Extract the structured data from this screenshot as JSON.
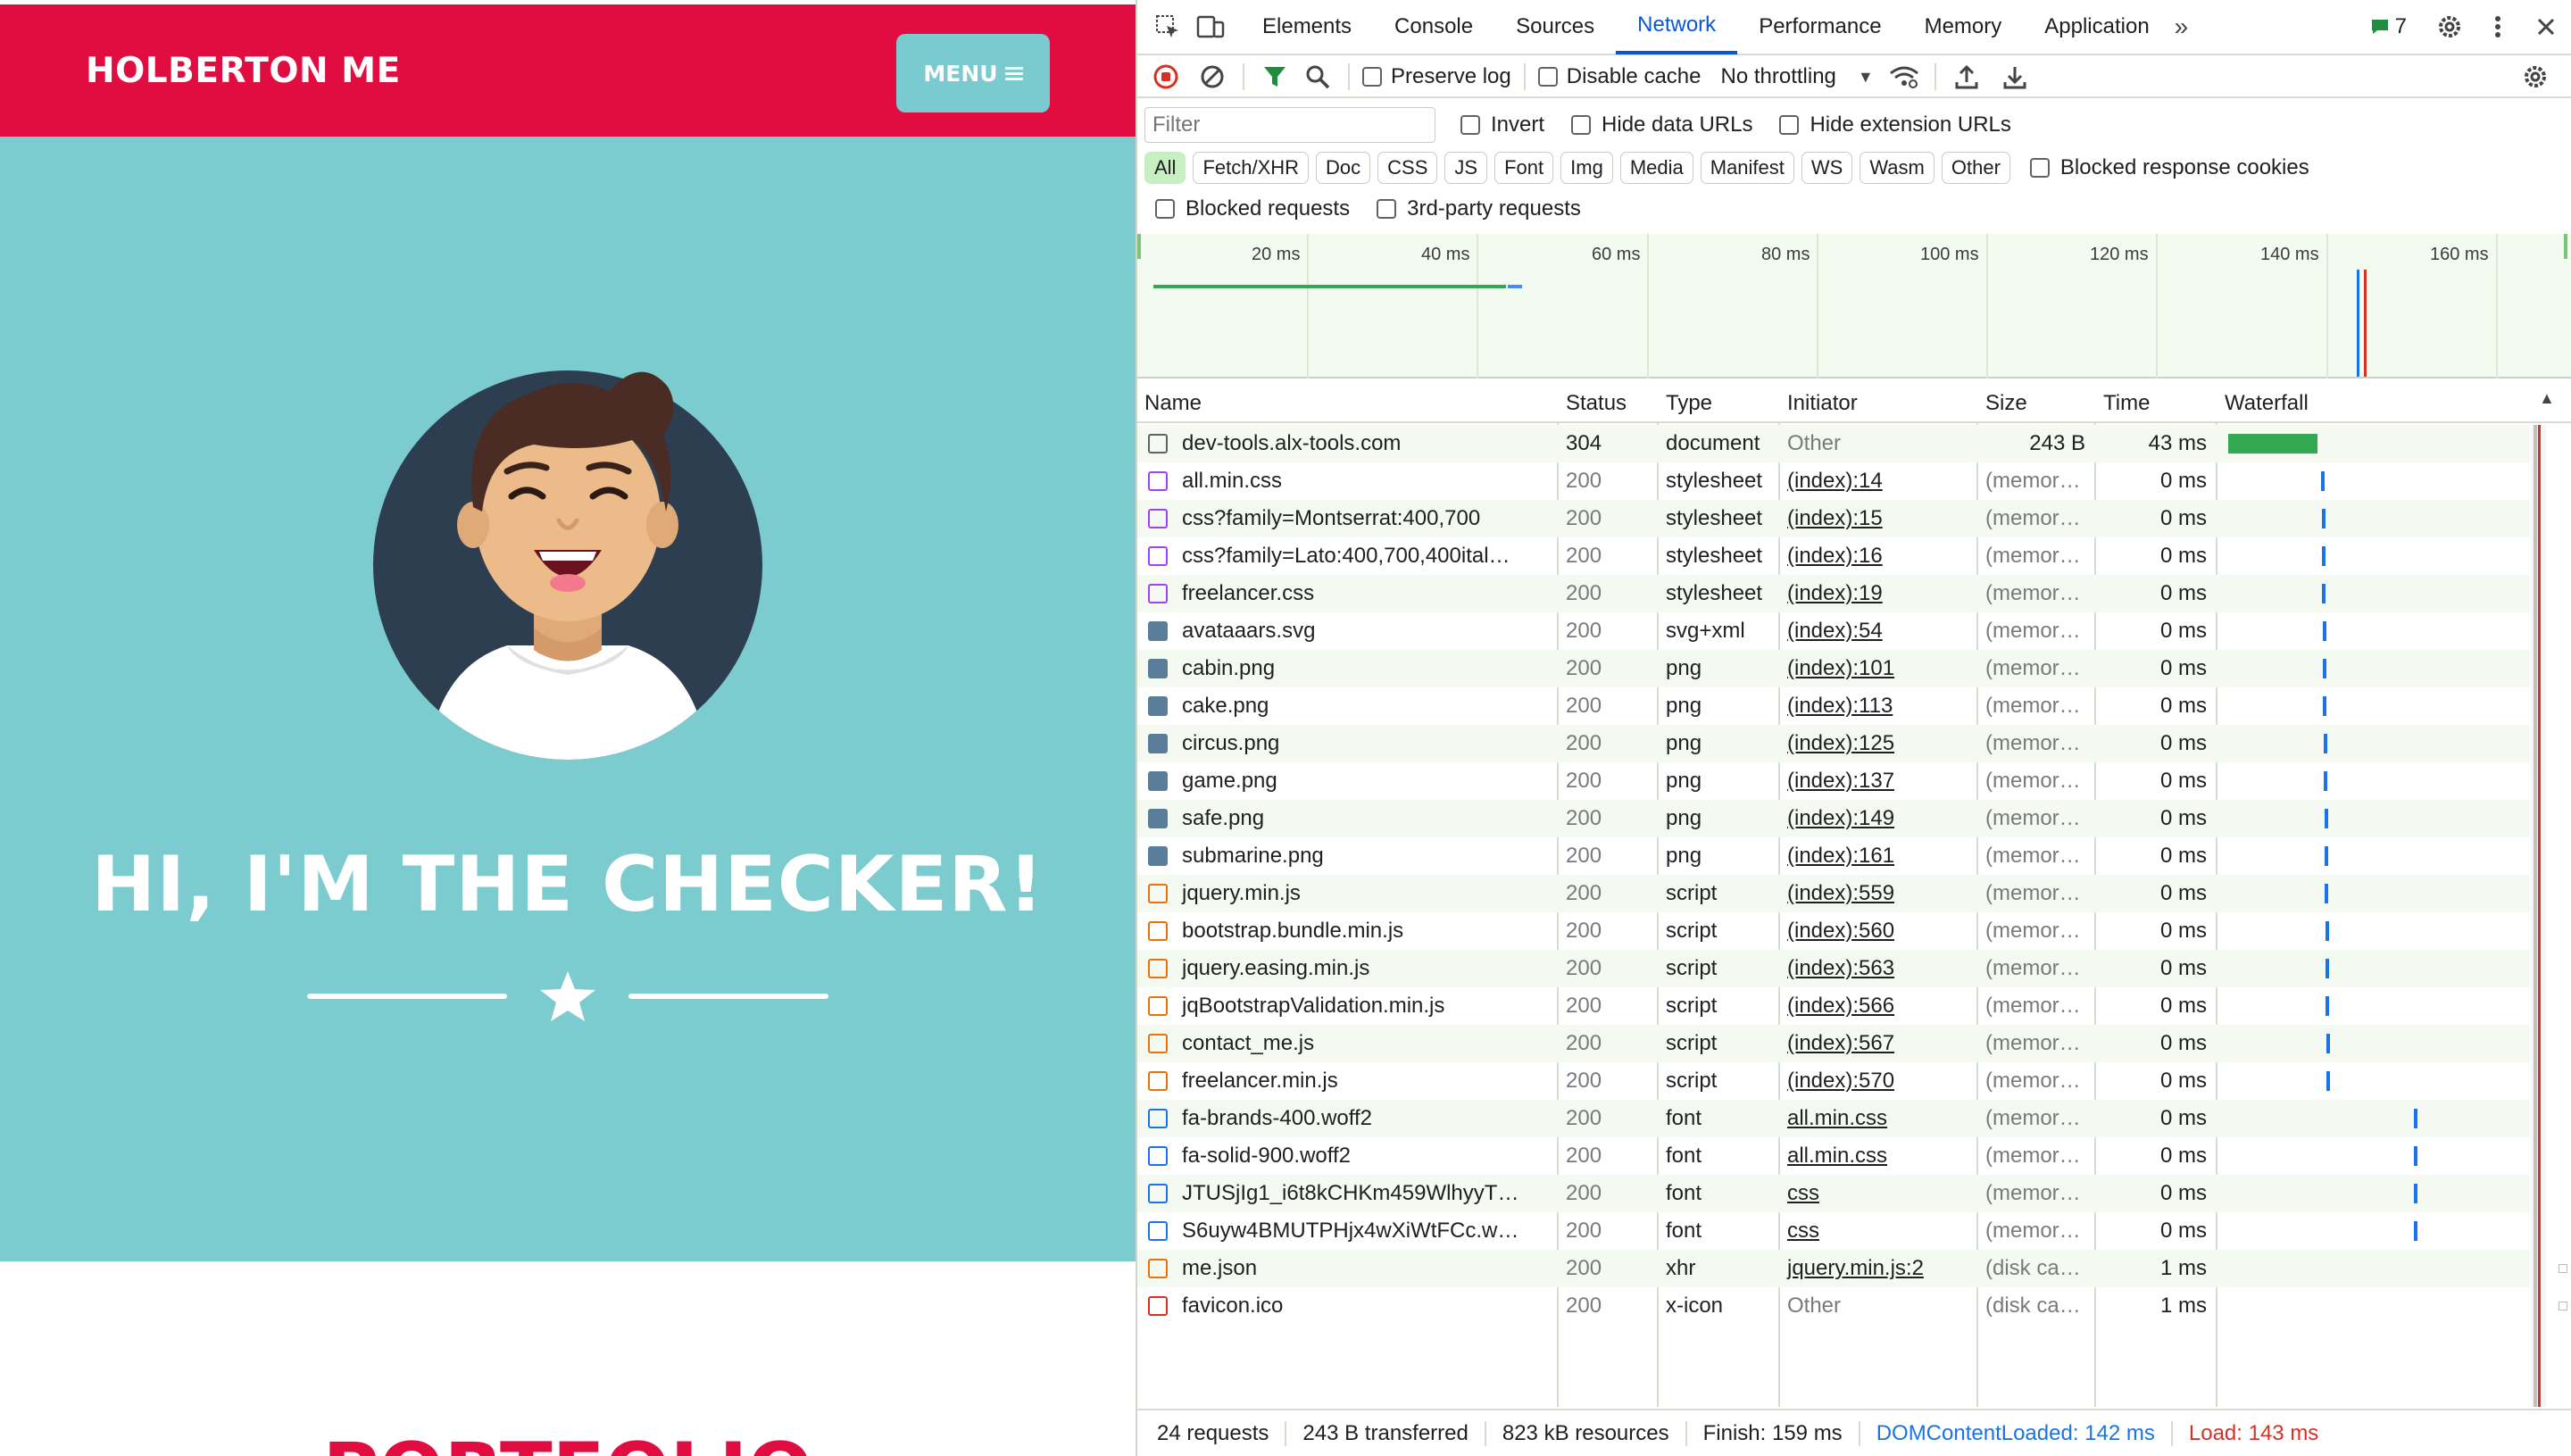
{
  "site": {
    "brand": "HOLBERTON ME",
    "menu_label": "MENU",
    "hero_title": "HI, I'M THE CHECKER!",
    "next_section_title": "PORTFOLIO",
    "colors": {
      "nav": "#e10c40",
      "hero": "#7ccbcf",
      "menu_button": "#79cbd0"
    }
  },
  "devtools": {
    "tabs": [
      "Elements",
      "Console",
      "Sources",
      "Network",
      "Performance",
      "Memory",
      "Application"
    ],
    "active_tab": "Network",
    "issues_count": "7",
    "toolbar": {
      "preserve_log": "Preserve log",
      "disable_cache": "Disable cache",
      "throttling": "No throttling"
    },
    "filter": {
      "placeholder": "Filter",
      "invert": "Invert",
      "hide_data_urls": "Hide data URLs",
      "hide_extension_urls": "Hide extension URLs",
      "type_chips": [
        "All",
        "Fetch/XHR",
        "Doc",
        "CSS",
        "JS",
        "Font",
        "Img",
        "Media",
        "Manifest",
        "WS",
        "Wasm",
        "Other"
      ],
      "active_chip": "All",
      "blocked_response_cookies": "Blocked response cookies",
      "blocked_requests": "Blocked requests",
      "third_party_requests": "3rd-party requests"
    },
    "overview_ticks": [
      "20 ms",
      "40 ms",
      "60 ms",
      "80 ms",
      "100 ms",
      "120 ms",
      "140 ms",
      "160 ms"
    ],
    "columns": [
      "Name",
      "Status",
      "Type",
      "Initiator",
      "Size",
      "Time",
      "Waterfall"
    ],
    "requests": [
      {
        "name": "dev-tools.alx-tools.com",
        "status": "304",
        "type": "document",
        "initiator": "Other",
        "size": "243 B",
        "time": "43 ms",
        "icon": "document-icon"
      },
      {
        "name": "all.min.css",
        "status": "200",
        "type": "stylesheet",
        "initiator": "(index):14",
        "size": "(memor…",
        "time": "0 ms",
        "icon": "stylesheet-icon"
      },
      {
        "name": "css?family=Montserrat:400,700",
        "status": "200",
        "type": "stylesheet",
        "initiator": "(index):15",
        "size": "(memor…",
        "time": "0 ms",
        "icon": "stylesheet-icon"
      },
      {
        "name": "css?family=Lato:400,700,400ital…",
        "status": "200",
        "type": "stylesheet",
        "initiator": "(index):16",
        "size": "(memor…",
        "time": "0 ms",
        "icon": "stylesheet-icon"
      },
      {
        "name": "freelancer.css",
        "status": "200",
        "type": "stylesheet",
        "initiator": "(index):19",
        "size": "(memor…",
        "time": "0 ms",
        "icon": "stylesheet-icon"
      },
      {
        "name": "avataaars.svg",
        "status": "200",
        "type": "svg+xml",
        "initiator": "(index):54",
        "size": "(memor…",
        "time": "0 ms",
        "icon": "image-icon"
      },
      {
        "name": "cabin.png",
        "status": "200",
        "type": "png",
        "initiator": "(index):101",
        "size": "(memor…",
        "time": "0 ms",
        "icon": "image-icon"
      },
      {
        "name": "cake.png",
        "status": "200",
        "type": "png",
        "initiator": "(index):113",
        "size": "(memor…",
        "time": "0 ms",
        "icon": "image-icon"
      },
      {
        "name": "circus.png",
        "status": "200",
        "type": "png",
        "initiator": "(index):125",
        "size": "(memor…",
        "time": "0 ms",
        "icon": "image-icon"
      },
      {
        "name": "game.png",
        "status": "200",
        "type": "png",
        "initiator": "(index):137",
        "size": "(memor…",
        "time": "0 ms",
        "icon": "image-icon"
      },
      {
        "name": "safe.png",
        "status": "200",
        "type": "png",
        "initiator": "(index):149",
        "size": "(memor…",
        "time": "0 ms",
        "icon": "image-icon"
      },
      {
        "name": "submarine.png",
        "status": "200",
        "type": "png",
        "initiator": "(index):161",
        "size": "(memor…",
        "time": "0 ms",
        "icon": "image-icon"
      },
      {
        "name": "jquery.min.js",
        "status": "200",
        "type": "script",
        "initiator": "(index):559",
        "size": "(memor…",
        "time": "0 ms",
        "icon": "script-icon"
      },
      {
        "name": "bootstrap.bundle.min.js",
        "status": "200",
        "type": "script",
        "initiator": "(index):560",
        "size": "(memor…",
        "time": "0 ms",
        "icon": "script-icon"
      },
      {
        "name": "jquery.easing.min.js",
        "status": "200",
        "type": "script",
        "initiator": "(index):563",
        "size": "(memor…",
        "time": "0 ms",
        "icon": "script-icon"
      },
      {
        "name": "jqBootstrapValidation.min.js",
        "status": "200",
        "type": "script",
        "initiator": "(index):566",
        "size": "(memor…",
        "time": "0 ms",
        "icon": "script-icon"
      },
      {
        "name": "contact_me.js",
        "status": "200",
        "type": "script",
        "initiator": "(index):567",
        "size": "(memor…",
        "time": "0 ms",
        "icon": "script-icon"
      },
      {
        "name": "freelancer.min.js",
        "status": "200",
        "type": "script",
        "initiator": "(index):570",
        "size": "(memor…",
        "time": "0 ms",
        "icon": "script-icon"
      },
      {
        "name": "fa-brands-400.woff2",
        "status": "200",
        "type": "font",
        "initiator": "all.min.css",
        "size": "(memor…",
        "time": "0 ms",
        "icon": "font-icon"
      },
      {
        "name": "fa-solid-900.woff2",
        "status": "200",
        "type": "font",
        "initiator": "all.min.css",
        "size": "(memor…",
        "time": "0 ms",
        "icon": "font-icon"
      },
      {
        "name": "JTUSjIg1_i6t8kCHKm459WlhyyT…",
        "status": "200",
        "type": "font",
        "initiator": "css",
        "size": "(memor…",
        "time": "0 ms",
        "icon": "font-icon"
      },
      {
        "name": "S6uyw4BMUTPHjx4wXiWtFCc.w…",
        "status": "200",
        "type": "font",
        "initiator": "css",
        "size": "(memor…",
        "time": "0 ms",
        "icon": "font-icon"
      },
      {
        "name": "me.json",
        "status": "200",
        "type": "xhr",
        "initiator": "jquery.min.js:2",
        "size": "(disk ca…",
        "time": "1 ms",
        "icon": "xhr-icon"
      },
      {
        "name": "favicon.ico",
        "status": "200",
        "type": "x-icon",
        "initiator": "Other",
        "size": "(disk ca…",
        "time": "1 ms",
        "icon": "favicon-icon"
      }
    ],
    "summary": {
      "requests": "24 requests",
      "transferred": "243 B transferred",
      "resources": "823 kB resources",
      "finish": "Finish: 159 ms",
      "dom_content_loaded": "DOMContentLoaded: 142 ms",
      "load": "Load: 143 ms"
    },
    "colors": {
      "active_tab": "#0b57d0",
      "record": "#d93025",
      "chip_active": "#c7f0c2",
      "load": "#d93025",
      "dcl": "#1a73e8"
    }
  }
}
